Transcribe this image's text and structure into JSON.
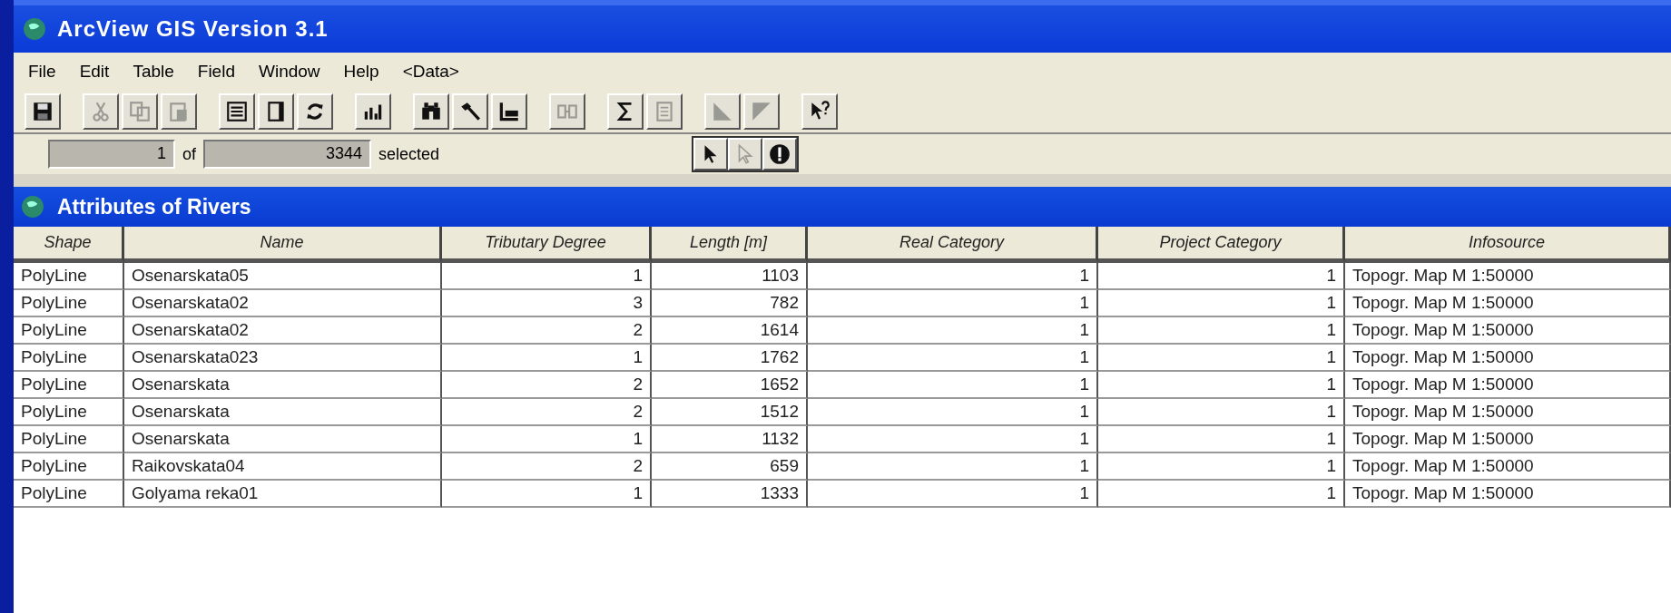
{
  "window": {
    "title": "ArcView GIS Version 3.1"
  },
  "menu": [
    "File",
    "Edit",
    "Table",
    "Field",
    "Window",
    "Help",
    "<Data>"
  ],
  "toolbar": [
    [
      {
        "kind": "save",
        "disabled": false
      }
    ],
    [
      {
        "kind": "cut",
        "disabled": true
      },
      {
        "kind": "copy",
        "disabled": true
      },
      {
        "kind": "paste",
        "disabled": true
      }
    ],
    [
      {
        "kind": "properties",
        "disabled": false
      },
      {
        "kind": "page",
        "disabled": false
      },
      {
        "kind": "refresh",
        "disabled": false
      }
    ],
    [
      {
        "kind": "chart",
        "disabled": false
      }
    ],
    [
      {
        "kind": "find",
        "disabled": false
      },
      {
        "kind": "query",
        "disabled": false
      },
      {
        "kind": "promote",
        "disabled": false
      }
    ],
    [
      {
        "kind": "join",
        "disabled": true
      }
    ],
    [
      {
        "kind": "sum",
        "disabled": false
      },
      {
        "kind": "calculate",
        "disabled": true
      }
    ],
    [
      {
        "kind": "sort-asc",
        "disabled": true
      },
      {
        "kind": "sort-desc",
        "disabled": true
      }
    ],
    [
      {
        "kind": "help",
        "disabled": false
      }
    ]
  ],
  "status": {
    "selected_count": "1",
    "of": "of",
    "total": "3344",
    "suffix": "selected"
  },
  "tools": [
    {
      "kind": "pointer",
      "disabled": false
    },
    {
      "kind": "select",
      "disabled": true
    },
    {
      "kind": "identify",
      "disabled": false
    }
  ],
  "table_window": {
    "title": "Attributes of Rivers"
  },
  "table": {
    "columns": [
      "Shape",
      "Name",
      "Tributary Degree",
      "Length [m]",
      "Real Category",
      "Project Category",
      "Infosource"
    ],
    "rows": [
      [
        "PolyLine",
        "Osenarskata05",
        "1",
        "1103",
        "1",
        "1",
        "Topogr. Map M 1:50000"
      ],
      [
        "PolyLine",
        "Osenarskata02",
        "3",
        "782",
        "1",
        "1",
        "Topogr. Map M 1:50000"
      ],
      [
        "PolyLine",
        "Osenarskata02",
        "2",
        "1614",
        "1",
        "1",
        "Topogr. Map M 1:50000"
      ],
      [
        "PolyLine",
        "Osenarskata023",
        "1",
        "1762",
        "1",
        "1",
        "Topogr. Map M 1:50000"
      ],
      [
        "PolyLine",
        "Osenarskata",
        "2",
        "1652",
        "1",
        "1",
        "Topogr. Map M 1:50000"
      ],
      [
        "PolyLine",
        "Osenarskata",
        "2",
        "1512",
        "1",
        "1",
        "Topogr. Map M 1:50000"
      ],
      [
        "PolyLine",
        "Osenarskata",
        "1",
        "1132",
        "1",
        "1",
        "Topogr. Map M 1:50000"
      ],
      [
        "PolyLine",
        "Raikovskata04",
        "2",
        "659",
        "1",
        "1",
        "Topogr. Map M 1:50000"
      ],
      [
        "PolyLine",
        "Golyama reka01",
        "1",
        "1333",
        "1",
        "1",
        "Topogr. Map M 1:50000"
      ]
    ]
  }
}
